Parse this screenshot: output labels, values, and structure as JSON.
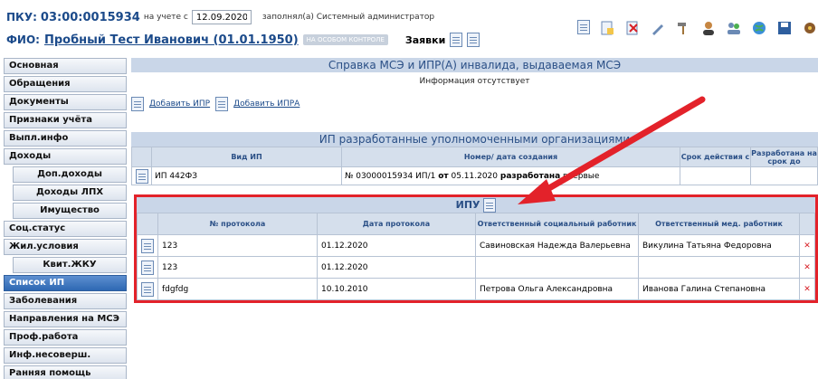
{
  "header": {
    "pku_label": "ПКУ:",
    "pku_value": "03:00:0015934",
    "on_record_label": "на учете с",
    "on_record_date": "12.09.2020",
    "filled_by": "заполнял(а) Системный администратор",
    "fio_label": "ФИО:",
    "fio_value": "Пробный Тест Иванович  (01.01.1950)",
    "control_badge": "НА ОСОБОМ КОНТРОЛЕ",
    "zayavki_label": "Заявки"
  },
  "sidebar": {
    "items": [
      {
        "label": "Основная"
      },
      {
        "label": "Обращения"
      },
      {
        "label": "Документы"
      },
      {
        "label": "Признаки учёта"
      },
      {
        "label": "Выпл.инфо"
      },
      {
        "label": "Доходы"
      },
      {
        "label": "Доп.доходы"
      },
      {
        "label": "Доходы ЛПХ"
      },
      {
        "label": "Имущество"
      },
      {
        "label": "Соц.статус"
      },
      {
        "label": "Жил.условия"
      },
      {
        "label": "Квит.ЖКУ"
      },
      {
        "label": "Список ИП"
      },
      {
        "label": "Заболевания"
      },
      {
        "label": "Направления на МСЭ"
      },
      {
        "label": "Проф.работа"
      },
      {
        "label": "Инф.несоверш."
      },
      {
        "label": "Ранняя помощь"
      }
    ]
  },
  "section_mse": {
    "title": "Справка МСЭ и ИПР(А) инвалида, выдаваемая МСЭ",
    "info": "Информация отсутствует",
    "add_ipr": "Добавить ИПР",
    "add_ipra": "Добавить ИПРА"
  },
  "section_ip": {
    "title": "ИП разработанные уполномоченными организациями",
    "columns": [
      "Вид ИП",
      "Номер/ дата создания",
      "Срок действия с",
      "Разработана на срок до"
    ],
    "rows": [
      {
        "vid": "ИП 442ФЗ",
        "nomer_prefix": "№ 03000015934 ИП/1 ",
        "ot": "от",
        "date": " 05.11.2020 ",
        "razrab": "разработана",
        "vpervye": " впервые"
      }
    ]
  },
  "section_ipu": {
    "title": "ИПУ",
    "columns": [
      "№ протокола",
      "Дата протокола",
      "Ответственный социальный работник",
      "Ответственный мед. работник"
    ],
    "rows": [
      {
        "num": "123",
        "date": "01.12.2020",
        "social": "Савиновская Надежда Валерьевна",
        "med": "Викулина Татьяна Федоровна"
      },
      {
        "num": "123",
        "date": "01.12.2020",
        "social": "",
        "med": ""
      },
      {
        "num": "fdgfdg",
        "date": "10.10.2010",
        "social": "Петрова Ольга Александровна",
        "med": "Иванова Галина Степановна"
      }
    ]
  },
  "colors": {
    "accent": "#1b4a8a",
    "highlight": "#e3222a",
    "header_bg": "#c9d6e8"
  }
}
